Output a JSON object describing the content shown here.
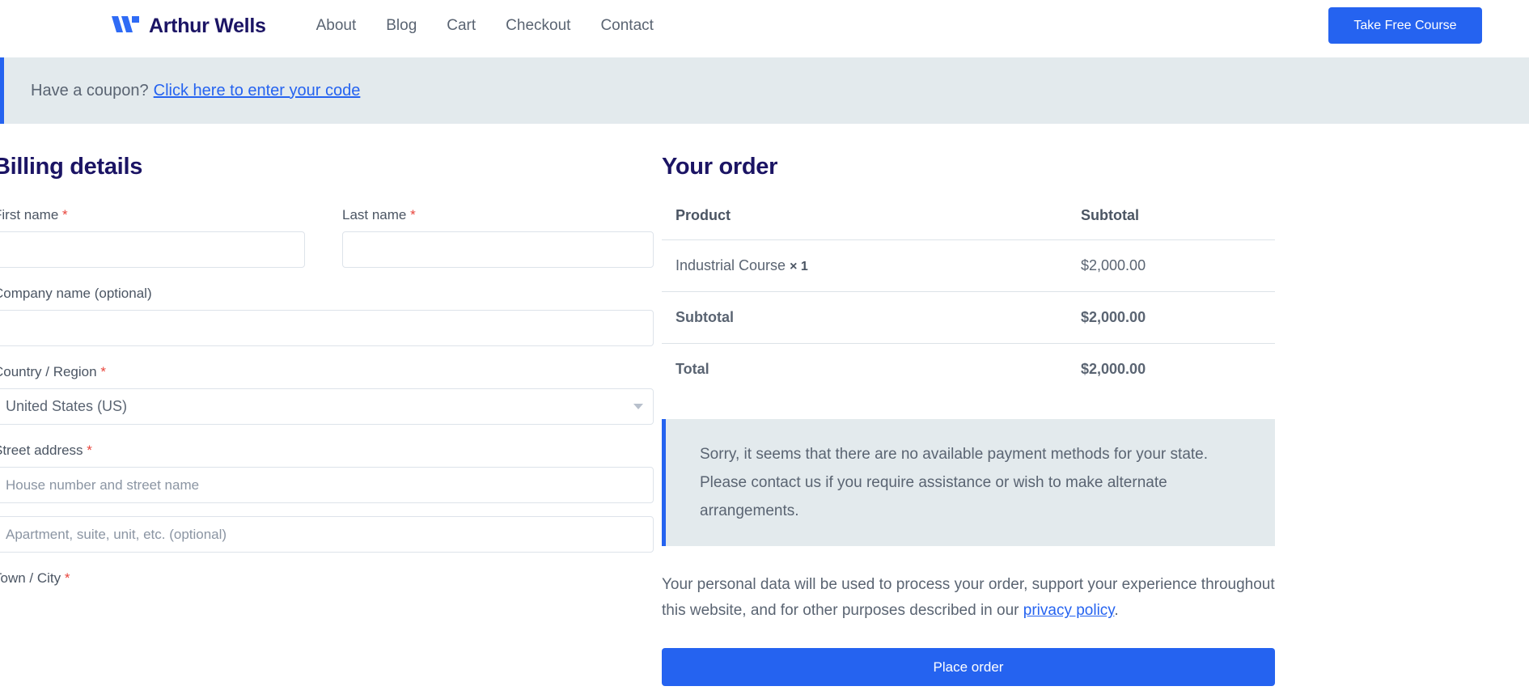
{
  "header": {
    "brand_name": "Arthur Wells",
    "logo_icon": "w-logo-icon",
    "nav": [
      {
        "label": "About"
      },
      {
        "label": "Blog"
      },
      {
        "label": "Cart"
      },
      {
        "label": "Checkout"
      },
      {
        "label": "Contact"
      }
    ],
    "cta_label": "Take Free Course",
    "accent_color": "#2563f0",
    "brand_color": "#1b1464"
  },
  "coupon": {
    "prompt": "Have a coupon?",
    "link_label": "Click here to enter your code",
    "background": "#e3eaed",
    "border_color": "#2563f0"
  },
  "billing": {
    "title": "Billing details",
    "required_mark": "*",
    "fields": {
      "first_name_label": "First name",
      "first_name_value": "",
      "last_name_label": "Last name",
      "last_name_value": "",
      "company_label": "Company name (optional)",
      "company_value": "",
      "country_label": "Country / Region",
      "country_value": "United States (US)",
      "street_label": "Street address",
      "street_placeholder": "House number and street name",
      "street_value": "",
      "apartment_placeholder": "Apartment, suite, unit, etc. (optional)",
      "apartment_value": "",
      "city_label": "Town / City",
      "city_value": ""
    }
  },
  "order": {
    "title": "Your order",
    "columns": {
      "product": "Product",
      "subtotal": "Subtotal"
    },
    "items": [
      {
        "name": "Industrial Course",
        "quantity": "× 1",
        "subtotal": "$2,000.00"
      }
    ],
    "summary": [
      {
        "label": "Subtotal",
        "value": "$2,000.00"
      },
      {
        "label": "Total",
        "value": "$2,000.00"
      }
    ]
  },
  "payment_notice": {
    "message": "Sorry, it seems that there are no available payment methods for your state. Please contact us if you require assistance or wish to make alternate arrangements."
  },
  "privacy": {
    "text_before": "Your personal data will be used to process your order, support your experience throughout this website, and for other purposes described in our ",
    "link_label": "privacy policy",
    "text_after": "."
  },
  "actions": {
    "place_order_label": "Place order"
  }
}
